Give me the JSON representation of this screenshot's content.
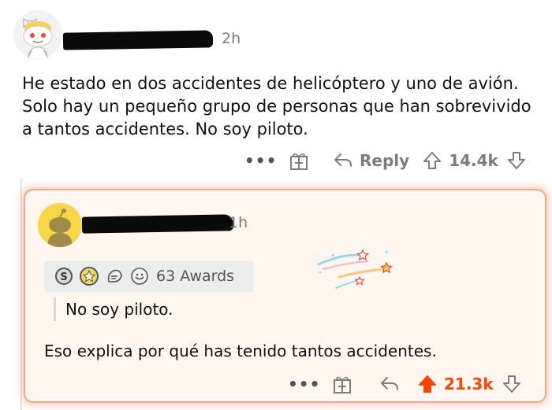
{
  "top_comment": {
    "time": "2h",
    "body": "He estado en dos accidentes de helicóptero y uno de avión. Solo hay un pequeño grupo de personas que han sobrevivido a tantos accidentes. No soy piloto.",
    "actions": {
      "more": "•••",
      "reply_label": "Reply",
      "score": "14.4k"
    }
  },
  "reply_comment": {
    "time": "1h",
    "awards_label": "63 Awards",
    "quote": "No soy piloto.",
    "body": "Eso explica por qué has tenido tantos accidentes.",
    "actions": {
      "more": "•••",
      "score": "21.3k"
    }
  },
  "colors": {
    "upvoted": "#ff4500",
    "highlight_border": "#f1a88c",
    "highlight_bg": "#fff6ef",
    "muted_text": "#7c7c7c"
  },
  "icons": [
    "snoo-avatar-icon",
    "gift-icon",
    "reply-arrow-icon",
    "upvote-icon",
    "downvote-icon",
    "silver-award-icon",
    "gold-award-icon",
    "wholesome-award-icon",
    "helpful-award-icon",
    "sparkle-decoration"
  ]
}
